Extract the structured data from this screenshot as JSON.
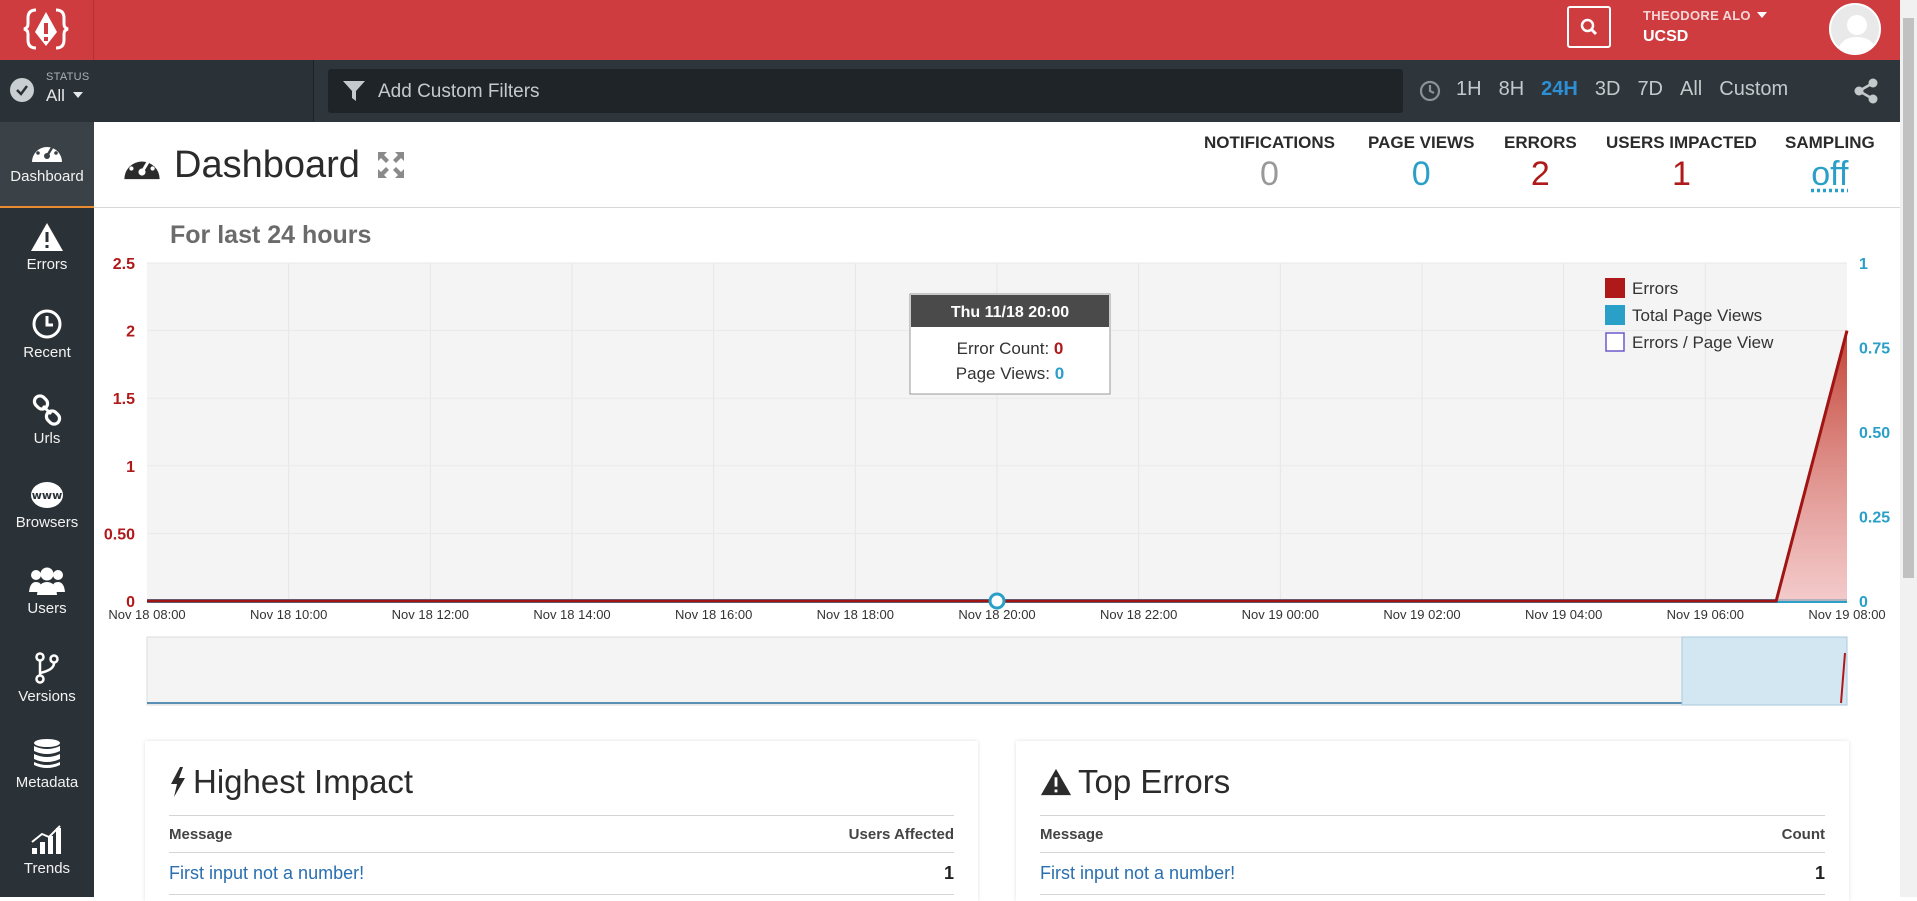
{
  "header": {
    "user_name": "THEODORE ALO",
    "org": "UCSD"
  },
  "subbar": {
    "status_label": "STATUS",
    "status_value": "All",
    "filter_placeholder": "Add Custom Filters",
    "ranges": [
      "1H",
      "8H",
      "24H",
      "3D",
      "7D",
      "All",
      "Custom"
    ],
    "active_range": "24H"
  },
  "sidebar": {
    "items": [
      {
        "label": "Dashboard",
        "icon": "dashboard-icon"
      },
      {
        "label": "Errors",
        "icon": "warning-icon"
      },
      {
        "label": "Recent",
        "icon": "clock-icon"
      },
      {
        "label": "Urls",
        "icon": "link-icon"
      },
      {
        "label": "Browsers",
        "icon": "www-icon"
      },
      {
        "label": "Users",
        "icon": "users-icon"
      },
      {
        "label": "Versions",
        "icon": "branch-icon"
      },
      {
        "label": "Metadata",
        "icon": "database-icon"
      },
      {
        "label": "Trends",
        "icon": "trends-icon"
      }
    ]
  },
  "page": {
    "title": "Dashboard",
    "period": "For last 24 hours"
  },
  "metrics": [
    {
      "label": "NOTIFICATIONS",
      "value": "0",
      "color": "#999999"
    },
    {
      "label": "PAGE VIEWS",
      "value": "0",
      "color": "#2a9fc8"
    },
    {
      "label": "ERRORS",
      "value": "2",
      "color": "#b01919"
    },
    {
      "label": "USERS IMPACTED",
      "value": "1",
      "color": "#b01919"
    },
    {
      "label": "SAMPLING",
      "value": "off",
      "color": "#2a9fc8"
    }
  ],
  "chart_data": {
    "type": "area",
    "x_ticks": [
      "Nov 18 08:00",
      "Nov 18 10:00",
      "Nov 18 12:00",
      "Nov 18 14:00",
      "Nov 18 16:00",
      "Nov 18 18:00",
      "Nov 18 20:00",
      "Nov 18 22:00",
      "Nov 19 00:00",
      "Nov 19 02:00",
      "Nov 19 04:00",
      "Nov 19 06:00",
      "Nov 19 08:00"
    ],
    "y_left_ticks": [
      "0",
      "0.50",
      "1",
      "1.5",
      "2",
      "2.5"
    ],
    "y_left_range": [
      0,
      2.5
    ],
    "y_right_ticks": [
      "0",
      "0.25",
      "0.50",
      "0.75",
      "1"
    ],
    "y_right_range": [
      0,
      1
    ],
    "legend": [
      {
        "name": "Errors",
        "color": "#b01919"
      },
      {
        "name": "Total Page Views",
        "color": "#2a9fc8"
      },
      {
        "name": "Errors / Page View",
        "color": "#6a5acd"
      }
    ],
    "legend_position": "top-right",
    "grid": true,
    "series": [
      {
        "name": "Errors",
        "axis": "left",
        "points": [
          [
            "Nov 18 08:00",
            0
          ],
          [
            "Nov 19 07:00",
            0
          ],
          [
            "Nov 19 08:00",
            2
          ]
        ]
      },
      {
        "name": "Total Page Views",
        "axis": "right",
        "points": [
          [
            "Nov 18 08:00",
            0
          ],
          [
            "Nov 19 08:00",
            0
          ]
        ]
      }
    ],
    "tooltip": {
      "title": "Thu 11/18 20:00",
      "lines": [
        {
          "label": "Error Count:",
          "value": "0",
          "color": "#b01919"
        },
        {
          "label": "Page Views:",
          "value": "0",
          "color": "#2a9fc8"
        }
      ]
    }
  },
  "panels": {
    "highest_impact": {
      "title": "Highest Impact",
      "col_message": "Message",
      "col_value": "Users Affected",
      "rows": [
        {
          "message": "First input not a number!",
          "value": "1"
        }
      ]
    },
    "top_errors": {
      "title": "Top Errors",
      "col_message": "Message",
      "col_value": "Count",
      "rows": [
        {
          "message": "First input not a number!",
          "value": "1"
        }
      ]
    }
  }
}
